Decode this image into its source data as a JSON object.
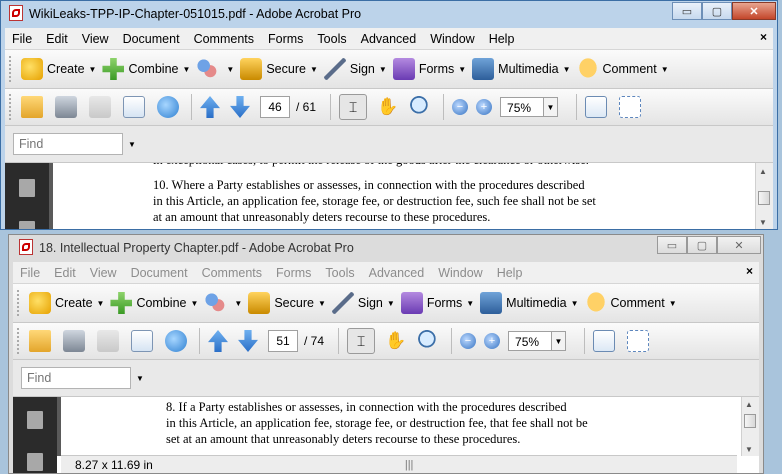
{
  "window1": {
    "title": "WikiLeaks-TPP-IP-Chapter-051015.pdf - Adobe Acrobat Pro",
    "page_current": "46",
    "page_total": "/ 61",
    "zoom": "75%",
    "doc_lines": [
      "10.      Where a Party establishes or assesses, in connection with the procedures described",
      "in this Article, an application fee, storage fee, or destruction fee, such fee shall not be set",
      "at an amount that unreasonably deters recourse to these procedures."
    ]
  },
  "window2": {
    "title": "18. Intellectual Property Chapter.pdf - Adobe Acrobat Pro",
    "page_current": "51",
    "page_total": "/ 74",
    "zoom": "75%",
    "doc_lines": [
      "8.       If a Party establishes or assesses, in connection with the procedures described",
      "in this Article, an application fee, storage fee, or destruction fee, that fee shall not be",
      "set at an amount that unreasonably deters recourse to these procedures."
    ],
    "status_size": "8.27 x 11.69 in"
  },
  "menu": [
    "File",
    "Edit",
    "View",
    "Document",
    "Comments",
    "Forms",
    "Tools",
    "Advanced",
    "Window",
    "Help"
  ],
  "tasks": {
    "create": "Create",
    "combine": "Combine",
    "secure": "Secure",
    "sign": "Sign",
    "forms": "Forms",
    "multimedia": "Multimedia",
    "comment": "Comment"
  },
  "find_placeholder": "Find",
  "doc_close": "×",
  "window_controls": {
    "minimize": "▭",
    "maximize": "▢",
    "close": "✕"
  },
  "colors": {
    "active_title": "#bcd3ea",
    "inactive_title": "#dcdcdc",
    "doc_bg": "#ffffff"
  }
}
